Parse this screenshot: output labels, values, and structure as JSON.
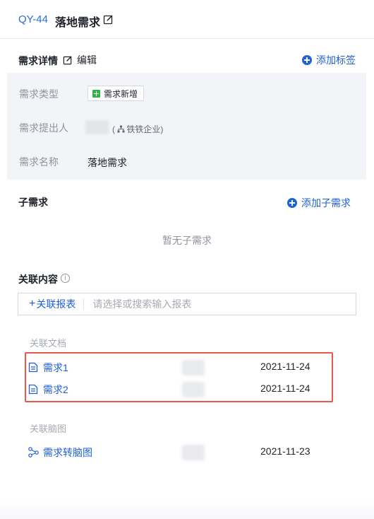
{
  "header": {
    "issue_id": "QY-44",
    "title": "落地需求",
    "edit_icon": "edit-icon"
  },
  "details": {
    "section_title": "需求详情",
    "edit_label": "编辑",
    "add_tag_label": "添加标签",
    "fields": {
      "type_label": "需求类型",
      "type_value": "需求新增",
      "submitter_label": "需求提出人",
      "submitter_org": "铁铁企业",
      "name_label": "需求名称",
      "name_value": "落地需求"
    }
  },
  "subreq": {
    "section_title": "子需求",
    "add_label": "添加子需求",
    "empty_text": "暂无子需求"
  },
  "related": {
    "section_title": "关联内容",
    "link_button": "关联报表",
    "search_placeholder": "请选择或搜索输入报表",
    "docs_label": "关联文档",
    "docs": [
      {
        "name": "需求1",
        "date": "2021-11-24",
        "icon": "document-icon"
      },
      {
        "name": "需求2",
        "date": "2021-11-24",
        "icon": "document-icon"
      }
    ],
    "mindmaps_label": "关联脑图",
    "mindmaps": [
      {
        "name": "需求转脑图",
        "date": "2021-11-23",
        "icon": "mindmap-icon"
      }
    ]
  },
  "colors": {
    "accent": "#2060d6",
    "highlight": "#e9584a",
    "tag_green": "#2fb344"
  }
}
